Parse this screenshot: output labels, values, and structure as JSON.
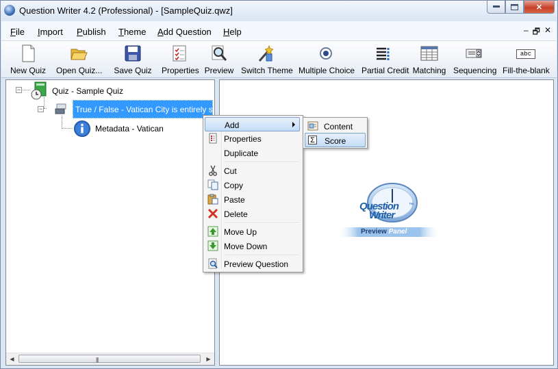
{
  "window": {
    "title": "Question Writer 4.2 (Professional) - [SampleQuiz.qwz]",
    "minimize_glyph": "▭",
    "maximize_glyph": "□",
    "close_glyph": "✕"
  },
  "menubar": {
    "items": [
      {
        "label": "File",
        "accel": "F",
        "rest": "ile"
      },
      {
        "label": "Import",
        "accel": "I",
        "rest": "mport"
      },
      {
        "label": "Publish",
        "accel": "P",
        "rest": "ublish"
      },
      {
        "label": "Theme",
        "accel": "T",
        "rest": "heme"
      },
      {
        "label": "Add Question",
        "accel": "A",
        "rest": "dd Question"
      },
      {
        "label": "Help",
        "accel": "H",
        "rest": "elp"
      }
    ],
    "mdi_min": "–",
    "mdi_restore": "🗗",
    "mdi_close": "✕"
  },
  "toolbar": {
    "buttons": [
      {
        "label": "New Quiz",
        "icon": "new-document-icon"
      },
      {
        "label": "Open Quiz...",
        "icon": "open-folder-icon"
      },
      {
        "label": "Save Quiz",
        "icon": "floppy-disk-icon"
      },
      {
        "label": "Properties",
        "icon": "properties-checklist-icon"
      },
      {
        "label": "Preview",
        "icon": "magnifier-icon"
      },
      {
        "label": "Switch Theme",
        "icon": "magic-wand-icon"
      },
      {
        "label": "Multiple Choice",
        "icon": "radio-button-icon"
      },
      {
        "label": "Partial Credit",
        "icon": "partial-credit-icon"
      },
      {
        "label": "Matching",
        "icon": "matching-grid-icon"
      },
      {
        "label": "Sequencing",
        "icon": "sequencing-icon"
      },
      {
        "label": "Fill-the-blank",
        "icon": "fill-blank-icon"
      }
    ],
    "fill_blank_icon_text": "abc"
  },
  "tree": {
    "root": {
      "label": "Quiz - Sample Quiz",
      "icon": "quiz-clock-icon"
    },
    "question": {
      "label": "True / False - Vatican City is entirely surrounded by Rome",
      "icon": "true-false-icon"
    },
    "metadata": {
      "label": "Metadata - Vatican",
      "icon": "info-icon"
    },
    "expander_glyph": "−"
  },
  "context_menu": {
    "items": [
      {
        "label": "Add",
        "icon": "",
        "has_submenu": true,
        "highlighted": true
      },
      {
        "label": "Properties",
        "icon": "properties-icon"
      },
      {
        "label": "Duplicate",
        "icon": ""
      },
      {
        "label": "Cut",
        "icon": "scissors-icon"
      },
      {
        "label": "Copy",
        "icon": "copy-icon"
      },
      {
        "label": "Paste",
        "icon": "paste-icon"
      },
      {
        "label": "Delete",
        "icon": "delete-x-icon"
      },
      {
        "label": "Move Up",
        "icon": "move-up-icon"
      },
      {
        "label": "Move Down",
        "icon": "move-down-icon"
      },
      {
        "label": "Preview Question",
        "icon": "preview-question-icon"
      }
    ]
  },
  "submenu": {
    "items": [
      {
        "label": "Content",
        "icon": "content-icon"
      },
      {
        "label": "Score",
        "icon": "sigma-icon",
        "highlighted": true
      }
    ],
    "sigma": "Σ"
  },
  "preview_logo": {
    "line1": "Question",
    "line2": "Writer",
    "tm": "™",
    "caption_a": "Preview",
    "caption_b": "Panel"
  },
  "colors": {
    "selection": "#3399ff",
    "menu_highlight": "#c4dcf6",
    "logo_blue": "#1d5fa8"
  }
}
